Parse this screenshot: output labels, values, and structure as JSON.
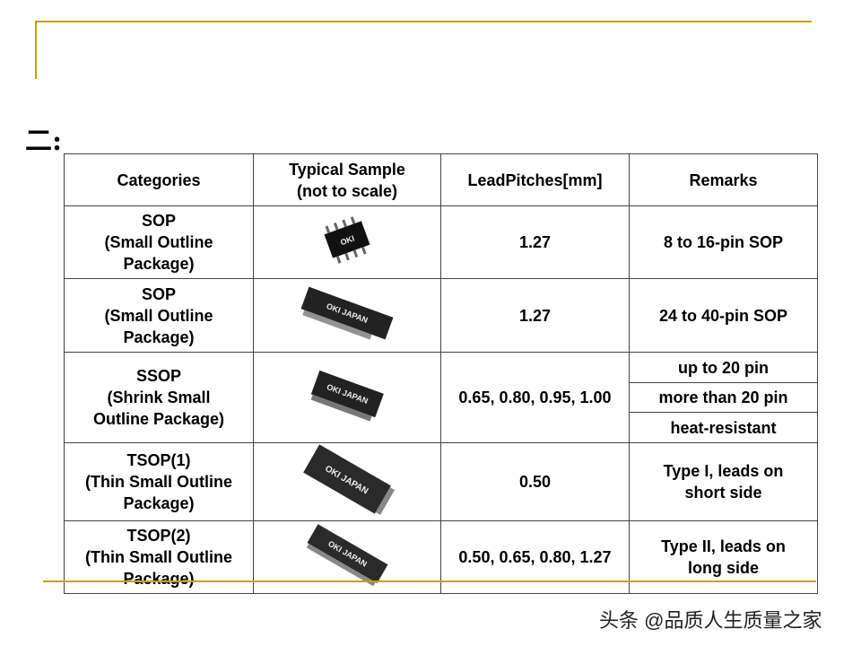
{
  "title": "二:",
  "headers": [
    "Categories",
    "Typical Sample\n(not to scale)",
    "LeadPitches[mm]",
    "Remarks"
  ],
  "rows": [
    {
      "category": "SOP\n(Small Outline\nPackage)",
      "pitch": "1.27",
      "remarks": [
        "8 to 16-pin SOP"
      ],
      "chip_label": "OKI"
    },
    {
      "category": "SOP\n(Small Outline\nPackage)",
      "pitch": "1.27",
      "remarks": [
        "24 to 40-pin SOP"
      ],
      "chip_label": "OKI JAPAN"
    },
    {
      "category": "SSOP\n(Shrink Small\nOutline Package)",
      "pitch": "0.65, 0.80, 0.95, 1.00",
      "remarks": [
        "up to 20 pin",
        "more than 20 pin",
        "heat-resistant"
      ],
      "chip_label": "OKI JAPAN"
    },
    {
      "category": "TSOP(1)\n(Thin Small Outline\nPackage)",
      "pitch": "0.50",
      "remarks": [
        "Type I, leads on\nshort side"
      ],
      "chip_label": "OKI JAPAN"
    },
    {
      "category": "TSOP(2)\n(Thin Small Outline\nPackage)",
      "pitch": "0.50, 0.65, 0.80, 1.27",
      "remarks": [
        "Type II, leads on\nlong side"
      ],
      "chip_label": "OKI JAPAN"
    }
  ],
  "watermark": "头条 @品质人生质量之家",
  "colors": {
    "accent": "#c8a000"
  }
}
